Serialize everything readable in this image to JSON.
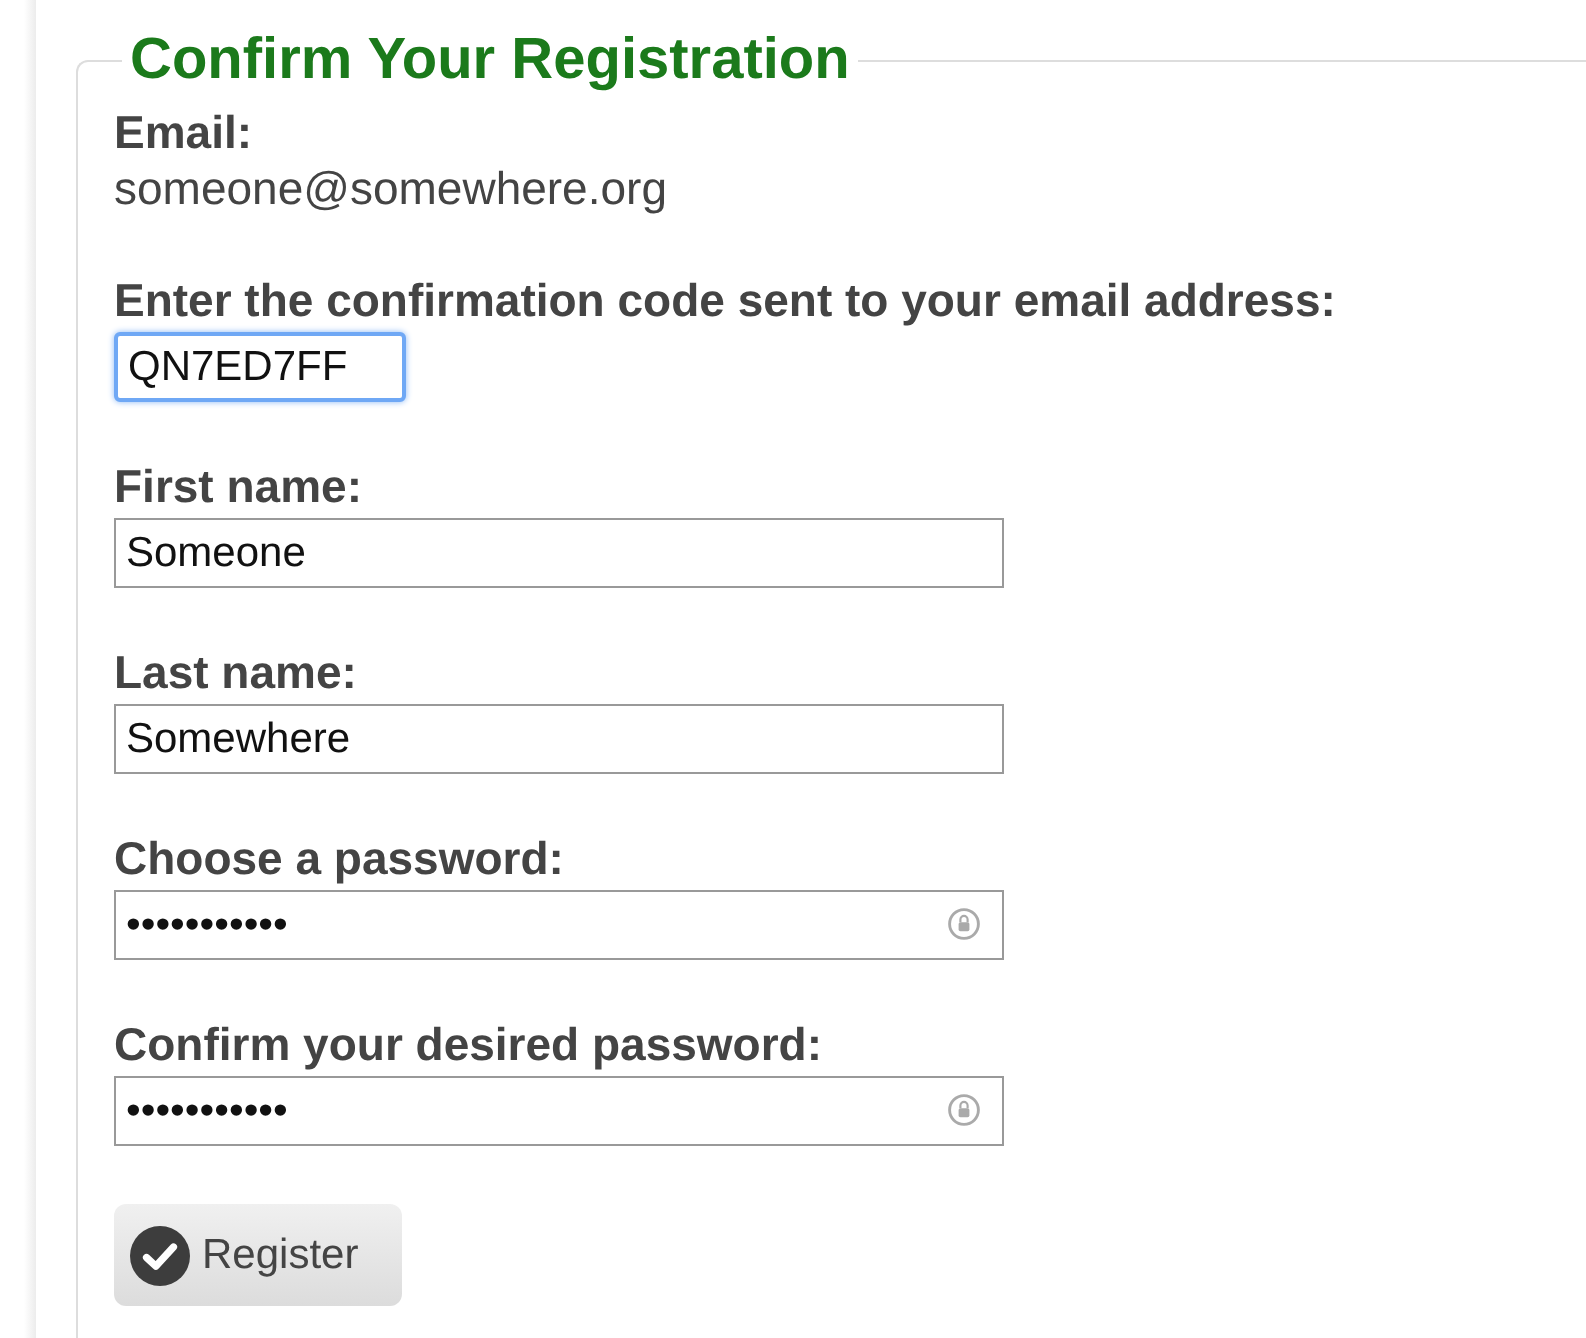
{
  "form": {
    "title": "Confirm Your Registration",
    "email": {
      "label": "Email:",
      "value": "someone@somewhere.org"
    },
    "fields": [
      {
        "kind": "code",
        "label": "Enter the confirmation code sent to your email address:",
        "value": "QN7ED7FF",
        "focused": true
      },
      {
        "kind": "text",
        "label": "First name:",
        "value": "Someone",
        "focused": false
      },
      {
        "kind": "text",
        "label": "Last name:",
        "value": "Somewhere",
        "focused": false
      },
      {
        "kind": "password",
        "label": "Choose a password:",
        "value": "•••••••••••",
        "focused": false
      },
      {
        "kind": "password",
        "label": "Confirm your desired password:",
        "value": "•••••••••••",
        "focused": false
      }
    ],
    "button": "Register"
  }
}
